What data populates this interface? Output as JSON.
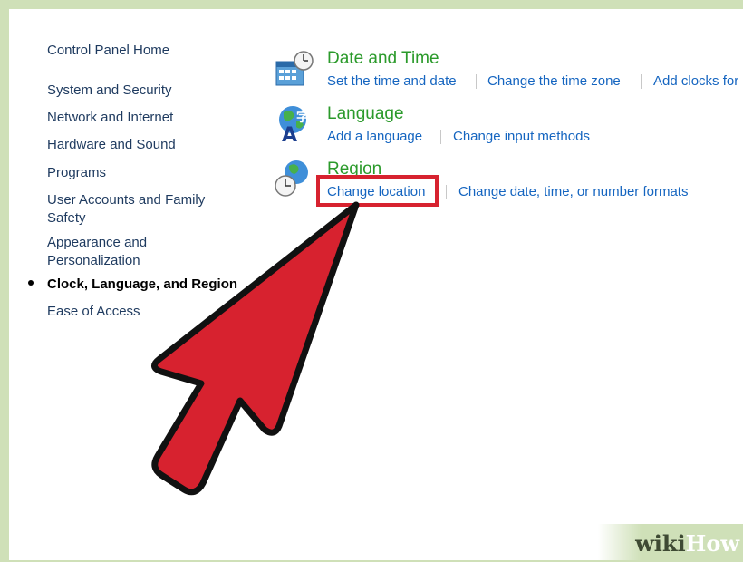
{
  "sidebar": {
    "items": [
      {
        "label": "Control Panel Home"
      },
      {
        "label": "System and Security"
      },
      {
        "label": "Network and Internet"
      },
      {
        "label": "Hardware and Sound"
      },
      {
        "label": "Programs"
      },
      {
        "label": "User Accounts and Family Safety"
      },
      {
        "label": "Appearance and Personalization"
      },
      {
        "label": "Clock, Language, and Region",
        "active": true
      },
      {
        "label": "Ease of Access"
      }
    ]
  },
  "categories": [
    {
      "title": "Date and Time",
      "icon": "calendar-clock-icon",
      "tasks": [
        "Set the time and date",
        "Change the time zone",
        "Add clocks for"
      ]
    },
    {
      "title": "Language",
      "icon": "language-globe-icon",
      "tasks": [
        "Add a language",
        "Change input methods"
      ]
    },
    {
      "title": "Region",
      "icon": "region-globe-clock-icon",
      "tasks": [
        "Change location",
        "Change date, time, or number formats"
      ]
    }
  ],
  "annotation": {
    "highlight_color": "#d7222f",
    "arrow_color": "#d7222f",
    "highlighted_task": "Change location"
  },
  "watermark": {
    "part1": "wiki",
    "part2": "How"
  },
  "colors": {
    "frame": "#cfe0b8",
    "category_title": "#2b9a2b",
    "task_link": "#1565c0",
    "sidebar_link": "#1e3a5f"
  }
}
